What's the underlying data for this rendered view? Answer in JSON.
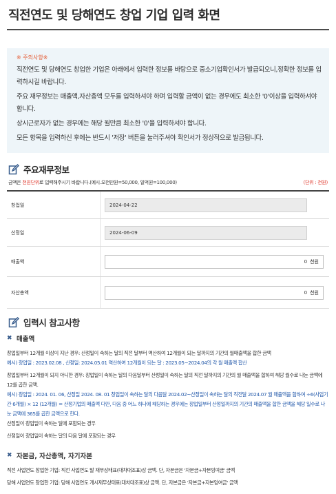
{
  "page": {
    "title": "직전연도 및 당해연도 창업 기업 입력 화면"
  },
  "notice": {
    "header": "※ 주의사항※",
    "lines": [
      "직전연도 및 당해연도 창업한 기업은 아래에서 입력한 정보를 바탕으로 중소기업확인서가 발급되오니,정확한 정보를 입력하시길 바랍니다.",
      "주요 재무정보는 매출액,자산총액 모두를 입력하셔야 하며 입력할 금액이 없는 경우에도 최소한 '0'이상을 입력하셔야 합니다.",
      "상시근로자가 없는 경우에는 해당 월만큼 최소한 '0'을 입력하셔야 합니다.",
      "모든 항목을 입력하신 후에는 반드시 '저장' 버튼을 눌러주셔야 확인서가 정상적으로 발급됩니다."
    ]
  },
  "financial": {
    "title": "주요재무정보",
    "unit_note_prefix": "금액은 ",
    "unit_note_highlight": "천원단위",
    "unit_note_suffix": "로 입력해주시기 바랍니다.(예시.오천만원=50,000, 일억원=100,000)",
    "unit_label": "(단위 : 천원)",
    "rows": [
      {
        "label": "창업일",
        "value": "2024-04-22"
      },
      {
        "label": "산정일",
        "value": "2024-06-09"
      },
      {
        "label": "매출액",
        "value": "0",
        "unit": "천원"
      },
      {
        "label": "자산총액",
        "value": "0",
        "unit": "천원"
      }
    ]
  },
  "reference": {
    "title": "입력시 참고사항",
    "sales": {
      "heading": "매출액",
      "lines": [
        "창업일부터 12개월 이상이 지난 경우: 산정일이 속하는 달의 직전 달부터 역산하여 12개월이 되는 달까지의 기간의 월매출액을 합한 금액",
        "예시) 창업일 : 2023.02.08 , 산정일: 2024.05.01 역산하여 12개월이 되는 달 : 2023.05~2024.04의 각 월 매출액 합산",
        "창업일부터 12개월이 되지 아니한 경우: 창업일이 속하는 달의 다음달부터 산정일이 속하는 달의 직전 달까지의 기간의 월 매출액을 합하여 해당 월수로 나눈 금액에 12를 곱한 금액.",
        "예시) 창업일 : 2024. 01. 06, 산정일 2024. 08. 01 창업일이 속하는 달의 다음달 2024.02~산정일이 속하는 달의 직전달 2024.07 월 매출액을 합하여 ÷6(사업기간 6개월) × 12 (12개월) = 산정기업의 매출액 다만, 다음 중 어느 하나에 해당하는 경우에는 창업일부터 산정일까지의 기간의 매출액을 합한 금액을 해당 일수로 나눈 금액에 365를 곱한 금액으로 한다.",
        "산정일이 창업일이 속하는 달에 포함되는 경우",
        "산정일이 창업일이 속하는 달의 다음 달에 포함되는 경우"
      ]
    },
    "capital": {
      "heading": "자본금, 자산총액, 자기자본",
      "lines": [
        "직전 사업연도 창업한 기업: 직전 사업연도 말 재무상태표(대차대조표)상 금액. 단, 자본금은 '자본금+자본잉여금' 금액",
        "당해 사업연도 창업한 기업: 당해 사업연도 개시재무상태표(대차대조표)상 금액. 단, 자본금은 '자본금+자본잉여금' 금액"
      ]
    }
  }
}
